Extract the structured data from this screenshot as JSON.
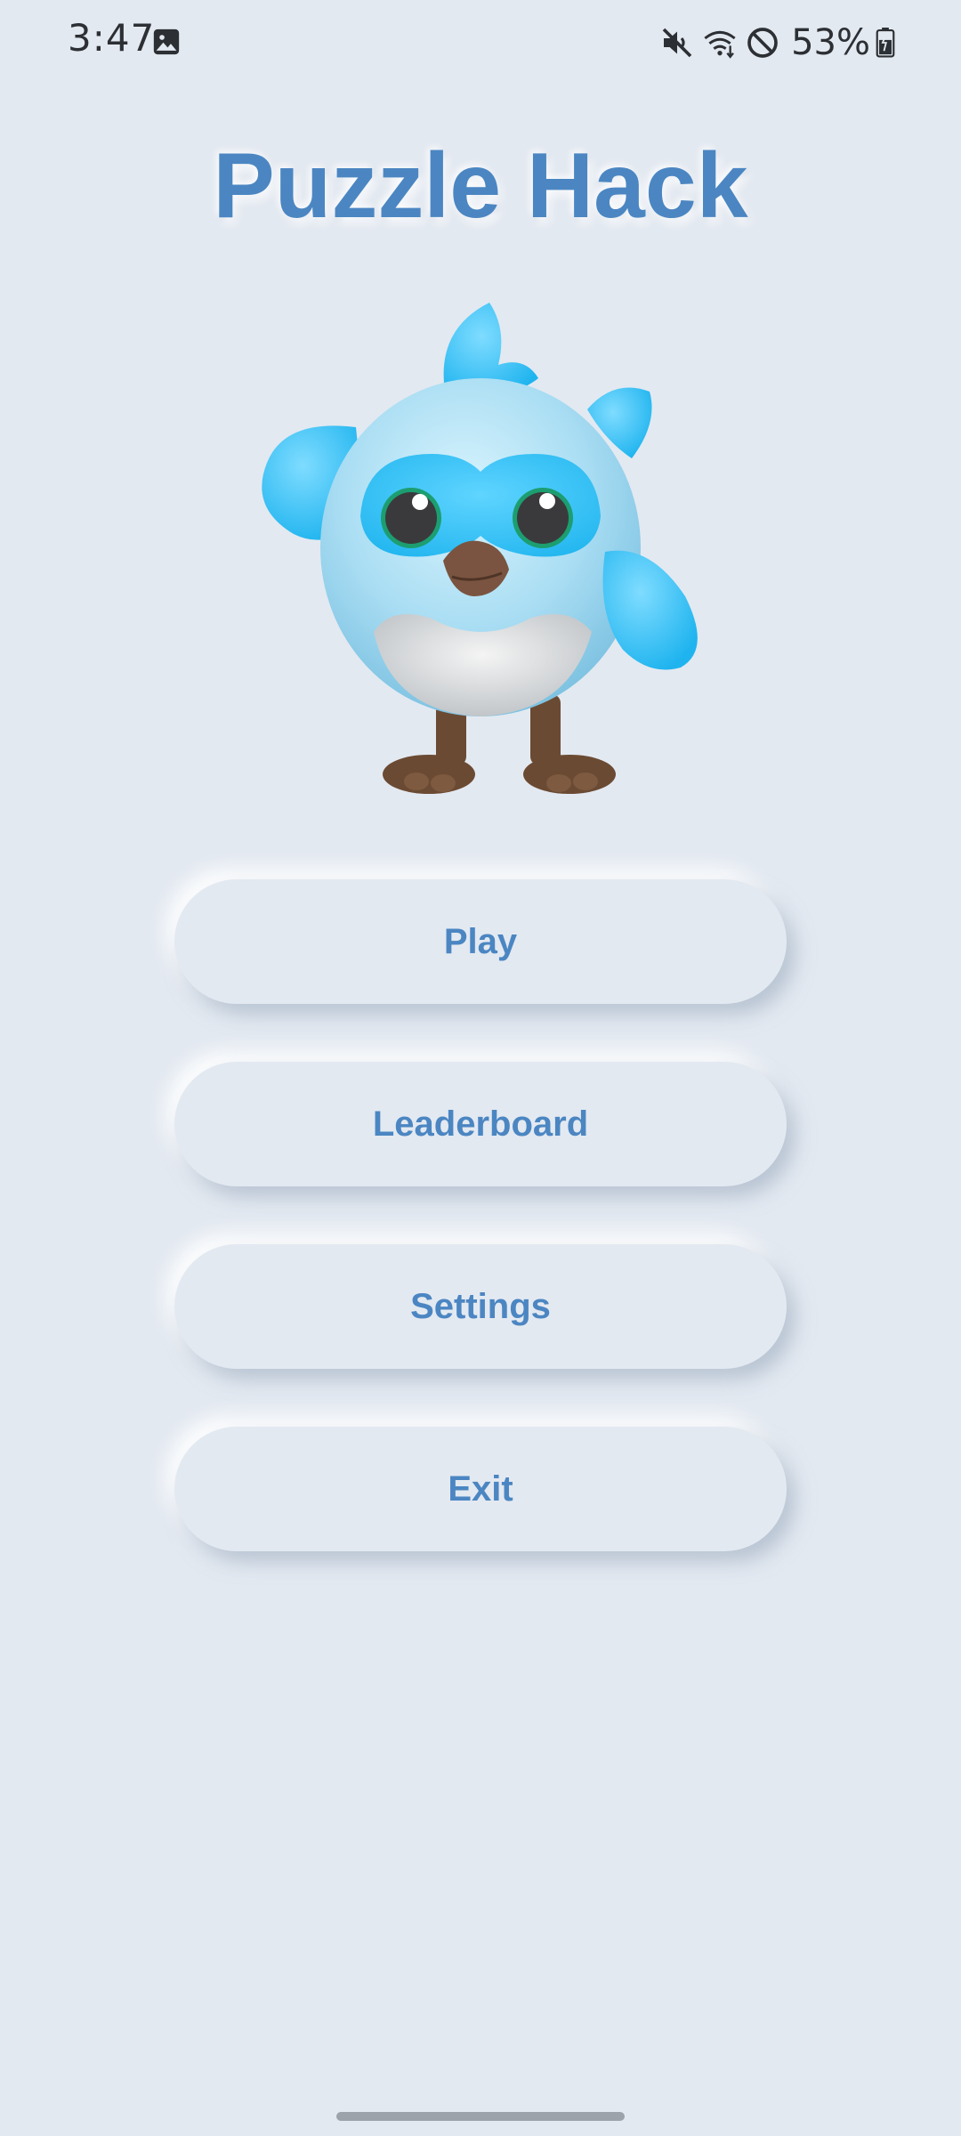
{
  "status_bar": {
    "time": "3:47",
    "battery_percent": "53%",
    "icons": [
      "gallery-icon",
      "mute-icon",
      "wifi-icon",
      "do-not-disturb-icon",
      "battery-icon"
    ]
  },
  "app": {
    "title": "Puzzle Hack",
    "mascot": "blue-bird-mascot"
  },
  "menu": {
    "play_label": "Play",
    "leaderboard_label": "Leaderboard",
    "settings_label": "Settings",
    "exit_label": "Exit"
  },
  "colors": {
    "background": "#e3e9f1",
    "accent": "#4b86c2",
    "bird_blue": "#3cc6f6",
    "bird_body": "#b5e3f6"
  }
}
